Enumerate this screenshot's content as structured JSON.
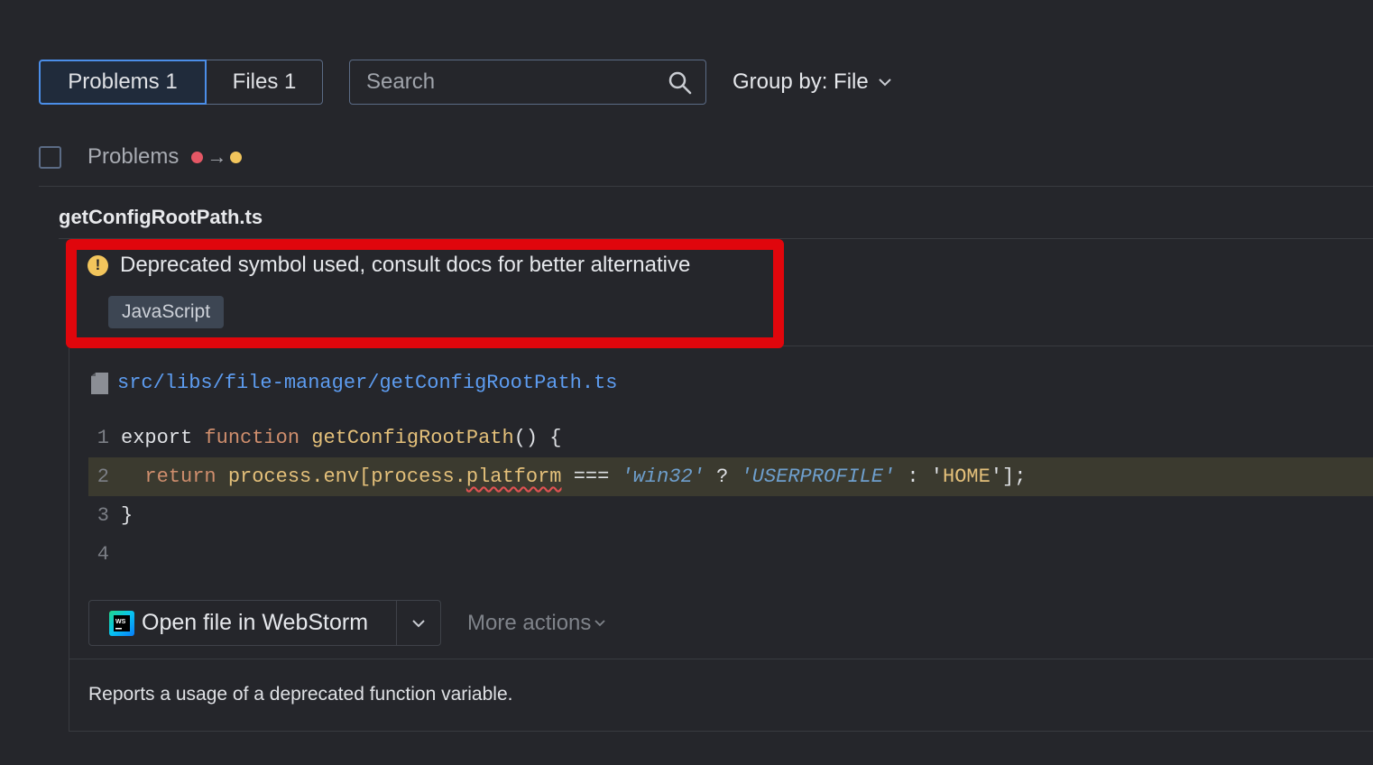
{
  "toolbar": {
    "tabs": [
      {
        "label": "Problems 1",
        "active": true
      },
      {
        "label": "Files 1",
        "active": false
      }
    ],
    "search_placeholder": "Search",
    "group_by_label": "Group by: File"
  },
  "list_header": {
    "label": "Problems",
    "severity_from_color": "#e55765",
    "severity_to_color": "#f2c55c"
  },
  "file_group": {
    "file_name": "getConfigRootPath.ts"
  },
  "problem": {
    "severity_icon": "warning-icon",
    "message": "Deprecated symbol used, consult docs for better alternative",
    "language_tag": "JavaScript"
  },
  "detail": {
    "file_path": "src/libs/file-manager/getConfigRootPath.ts",
    "code_lines": [
      {
        "number": "1"
      },
      {
        "number": "2"
      },
      {
        "number": "3"
      },
      {
        "number": "4"
      }
    ],
    "code": {
      "l1_export": "export ",
      "l1_function": "function ",
      "l1_name": "getConfigRootPath",
      "l1_rest": "() {",
      "l2_return": "return ",
      "l2_process_env": "process.env[process.",
      "l2_platform": "platform",
      "l2_op": " === ",
      "l2_win32": "'win32'",
      "l2_q": " ? ",
      "l2_userprofile": "'USERPROFILE'",
      "l2_colon": " : ",
      "l2_home_open": "'",
      "l2_home": "HOME",
      "l2_end": "'];",
      "l3": "}"
    },
    "open_button_label": "Open file in WebStorm",
    "more_actions_label": "More actions",
    "description": "Reports a usage of a deprecated function variable."
  }
}
